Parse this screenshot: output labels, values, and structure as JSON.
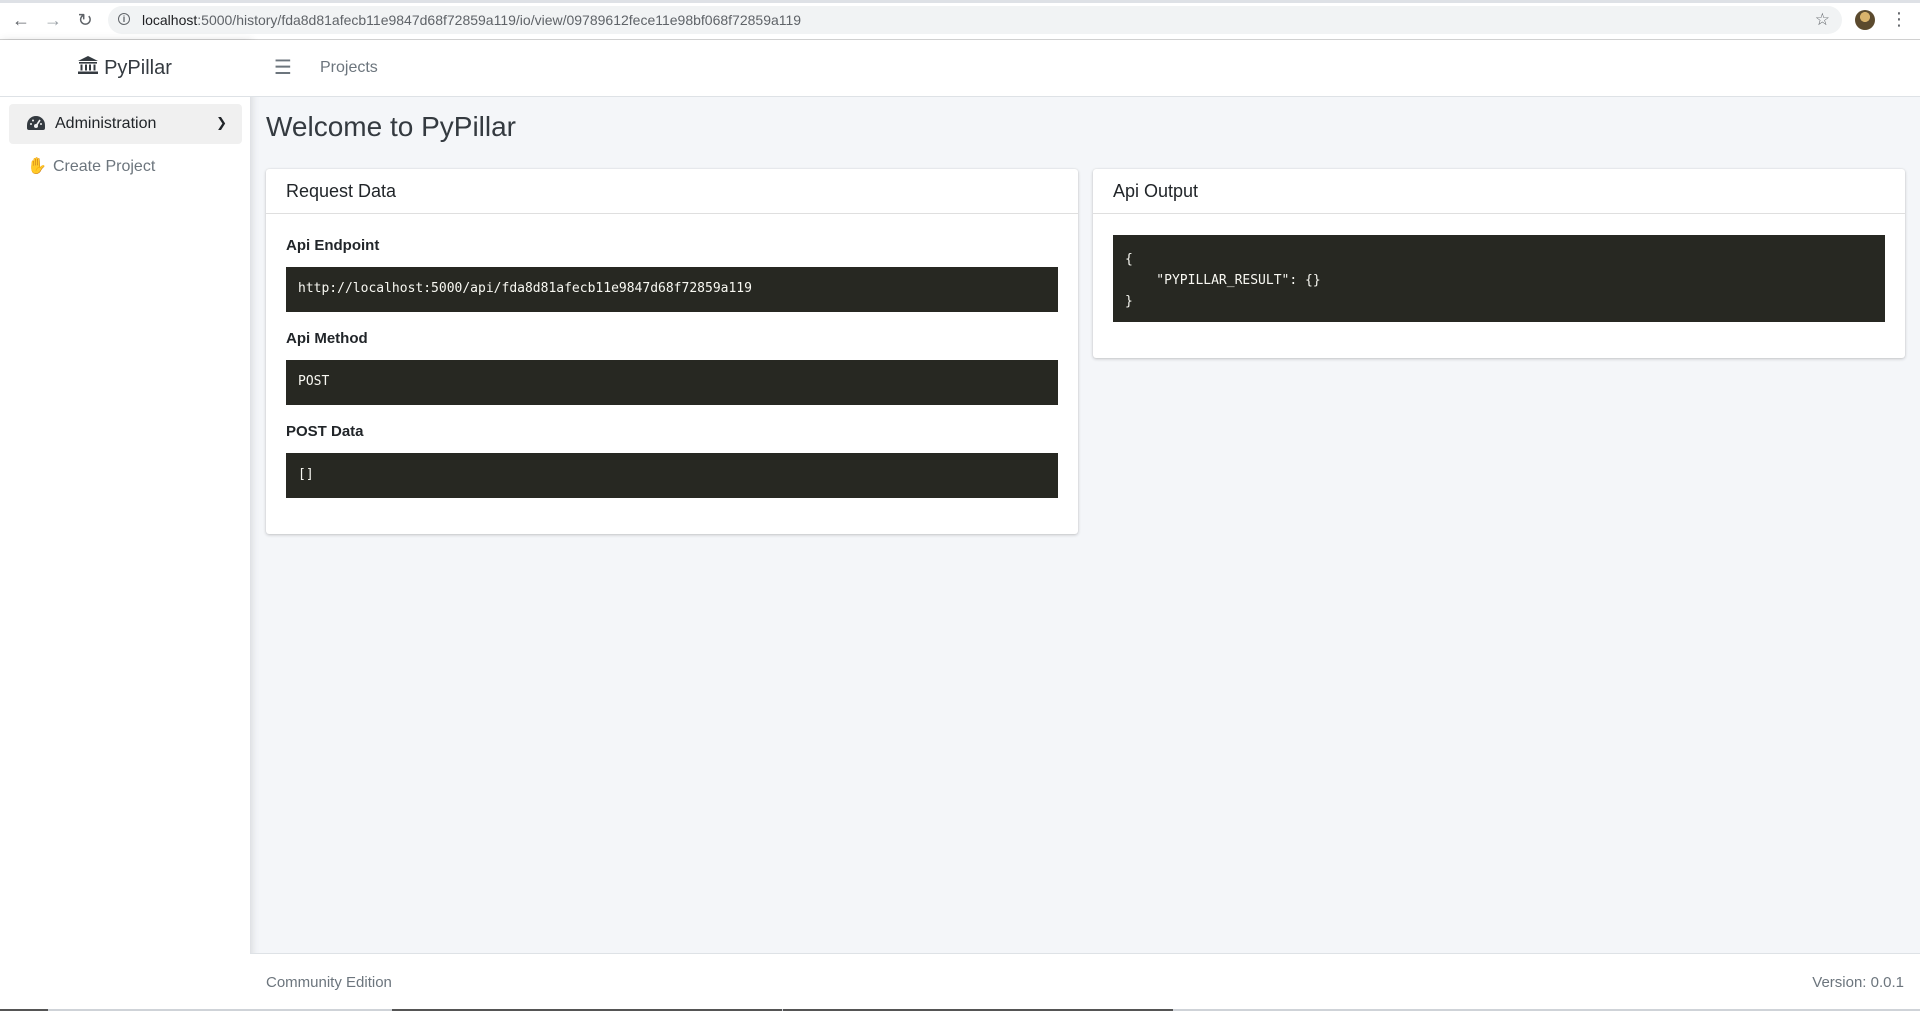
{
  "browser": {
    "url_host": "localhost",
    "url_rest": ":5000/history/fda8d81afecb11e9847d68f72859a119/io/view/09789612fece11e98bf068f72859a119"
  },
  "sidebar": {
    "brand": "PyPillar",
    "items": [
      {
        "label": "Administration",
        "icon": "gauge-icon"
      },
      {
        "label": "Create Project",
        "icon": "hand-icon"
      }
    ]
  },
  "topnav": {
    "projects_label": "Projects"
  },
  "main": {
    "title": "Welcome to PyPillar",
    "request_card": {
      "header": "Request Data",
      "endpoint_label": "Api Endpoint",
      "endpoint_value": "http://localhost:5000/api/fda8d81afecb11e9847d68f72859a119",
      "method_label": "Api Method",
      "method_value": "POST",
      "post_label": "POST Data",
      "post_value": "[]"
    },
    "output_card": {
      "header": "Api Output",
      "output_value": "{\n    \"PYPILLAR_RESULT\": {}\n}"
    }
  },
  "footer": {
    "edition": "Community Edition",
    "version": "Version: 0.0.1"
  },
  "colors": {
    "code_bg": "#272822",
    "code_fg": "#f8f8f2",
    "page_bg": "#f4f6f9"
  }
}
